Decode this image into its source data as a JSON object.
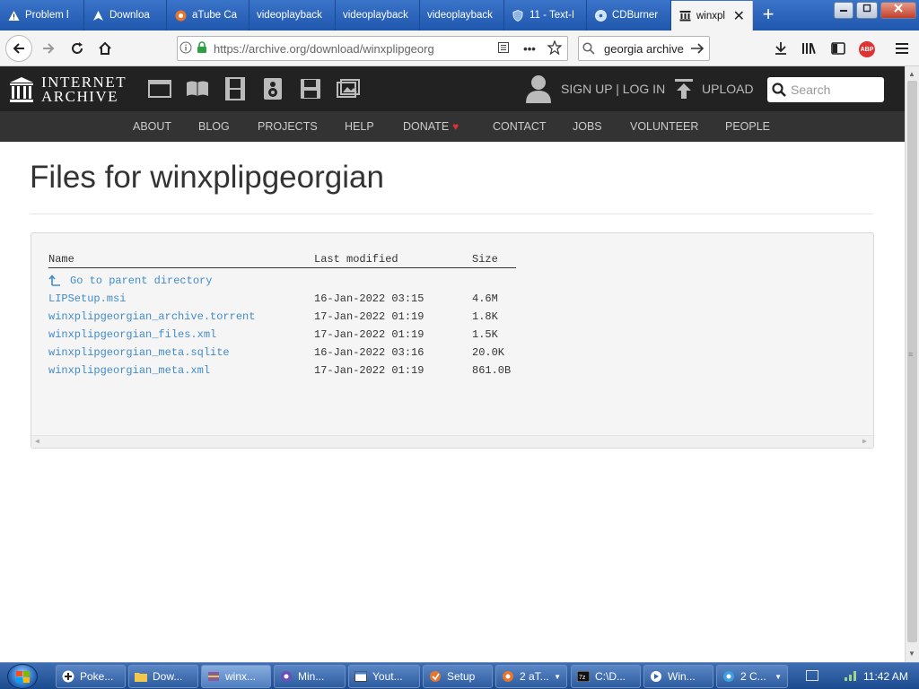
{
  "browser": {
    "tabs": [
      {
        "label": "Problem l",
        "icon": "warning-icon"
      },
      {
        "label": "Downloa",
        "icon": "download-icon"
      },
      {
        "label": "aTube Ca",
        "icon": "atube-icon"
      },
      {
        "label": "videoplayback",
        "icon": ""
      },
      {
        "label": "videoplayback",
        "icon": ""
      },
      {
        "label": "videoplayback",
        "icon": ""
      },
      {
        "label": "11 - Text-I",
        "icon": "shield-icon"
      },
      {
        "label": "CDBurner",
        "icon": "cdburner-icon"
      },
      {
        "label": "winxpl",
        "icon": "archive-icon"
      }
    ],
    "new_tab": "+",
    "url": "https://archive.org/download/winxplipgeorg",
    "search_text": "georgia archive"
  },
  "ia": {
    "logo_line1": "INTERNET",
    "logo_line2": "ARCHIVE",
    "signup_login": "SIGN UP | LOG IN",
    "upload": "UPLOAD",
    "search_placeholder": "Search",
    "nav": [
      "ABOUT",
      "BLOG",
      "PROJECTS",
      "HELP",
      "DONATE",
      "CONTACT",
      "JOBS",
      "VOLUNTEER",
      "PEOPLE"
    ],
    "donate_heart": "♥"
  },
  "page": {
    "title": "Files for winxplipgeorgian",
    "columns": {
      "name": "Name",
      "modified": "Last modified",
      "size": "Size"
    },
    "parent_link": "Go to parent directory",
    "files": [
      {
        "name": "LIPSetup.msi",
        "modified": "16-Jan-2022 03:15",
        "size": "4.6M"
      },
      {
        "name": "winxplipgeorgian_archive.torrent",
        "modified": "17-Jan-2022 01:19",
        "size": "1.8K"
      },
      {
        "name": "winxplipgeorgian_files.xml",
        "modified": "17-Jan-2022 01:19",
        "size": "1.5K"
      },
      {
        "name": "winxplipgeorgian_meta.sqlite",
        "modified": "16-Jan-2022 03:16",
        "size": "20.0K"
      },
      {
        "name": "winxplipgeorgian_meta.xml",
        "modified": "17-Jan-2022 01:19",
        "size": "861.0B"
      }
    ]
  },
  "taskbar": {
    "items": [
      {
        "label": "Poke...",
        "icon": "plus-icon"
      },
      {
        "label": "Dow...",
        "icon": "folder-icon"
      },
      {
        "label": "winx...",
        "icon": "winrar-icon"
      },
      {
        "label": "Min...",
        "icon": "minecraft-icon"
      },
      {
        "label": "Yout...",
        "icon": "window-icon"
      },
      {
        "label": "Setup",
        "icon": "setup-icon"
      },
      {
        "label": "2 aT...",
        "icon": "atube-icon"
      },
      {
        "label": "C:\\D...",
        "icon": "7zip-icon"
      },
      {
        "label": "Win...",
        "icon": "media-player-icon"
      },
      {
        "label": "2 C...",
        "icon": "chrome-icon"
      }
    ],
    "clock": "11:42 AM"
  }
}
